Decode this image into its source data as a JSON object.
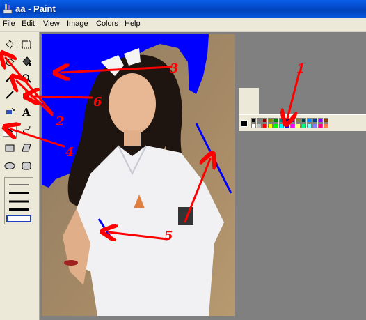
{
  "window": {
    "title": "aa - Paint"
  },
  "menu": {
    "items": [
      "File",
      "Edit",
      "View",
      "Image",
      "Colors",
      "Help"
    ]
  },
  "annotations": {
    "numbers": [
      "1",
      "2",
      "3",
      "4",
      "5",
      "6"
    ]
  },
  "colors": {
    "accent_red": "#ff0000",
    "paint_blue": "#0000ff",
    "titlebar": "#0447c9",
    "chrome": "#ece9d8",
    "workspace": "#808080"
  },
  "palette": {
    "row1": [
      "#000000",
      "#808080",
      "#800000",
      "#808000",
      "#008000",
      "#008080",
      "#000080",
      "#800080",
      "#808040",
      "#004040",
      "#0080ff",
      "#004080",
      "#8000ff",
      "#804000"
    ],
    "row2": [
      "#ffffff",
      "#c0c0c0",
      "#ff0000",
      "#ffff00",
      "#00ff00",
      "#00ffff",
      "#0000ff",
      "#ff00ff",
      "#ffff80",
      "#00ff80",
      "#80ffff",
      "#8080ff",
      "#ff0080",
      "#ff8040"
    ]
  },
  "tools": [
    "free-select",
    "select",
    "eraser",
    "fill",
    "color-picker",
    "magnifier",
    "pencil",
    "brush",
    "airbrush",
    "text",
    "line",
    "curve",
    "rectangle",
    "polygon",
    "ellipse",
    "rounded-rectangle"
  ]
}
